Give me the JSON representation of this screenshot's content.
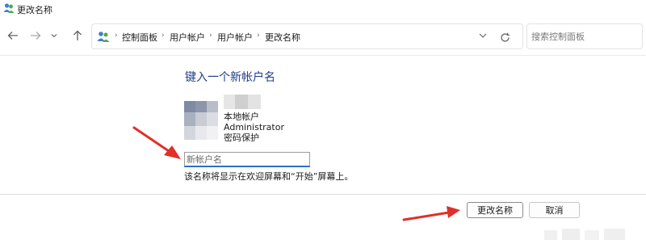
{
  "window": {
    "title": "更改名称"
  },
  "nav": {
    "back_icon": "arrow-left-icon",
    "forward_icon": "arrow-right-icon",
    "recent_icon": "chevron-down-icon",
    "up_icon": "arrow-up-icon",
    "breadcrumbs": [
      "控制面板",
      "用户帐户",
      "用户帐户",
      "更改名称"
    ],
    "search_placeholder": "搜索控制面板"
  },
  "main": {
    "heading": "键入一个新帐户名",
    "account": {
      "type": "本地帐户",
      "name": "Administrator",
      "protection": "密码保护"
    },
    "new_name_placeholder": "新帐户名",
    "new_name_value": "",
    "hint": "该名称将显示在欢迎屏幕和“开始”屏幕上。"
  },
  "buttons": {
    "change_name": "更改名称",
    "cancel": "取消"
  },
  "colors": {
    "heading": "#1e3c8a",
    "focus_underline": "#2d6fc9",
    "annotation_arrow": "#e0302a"
  }
}
